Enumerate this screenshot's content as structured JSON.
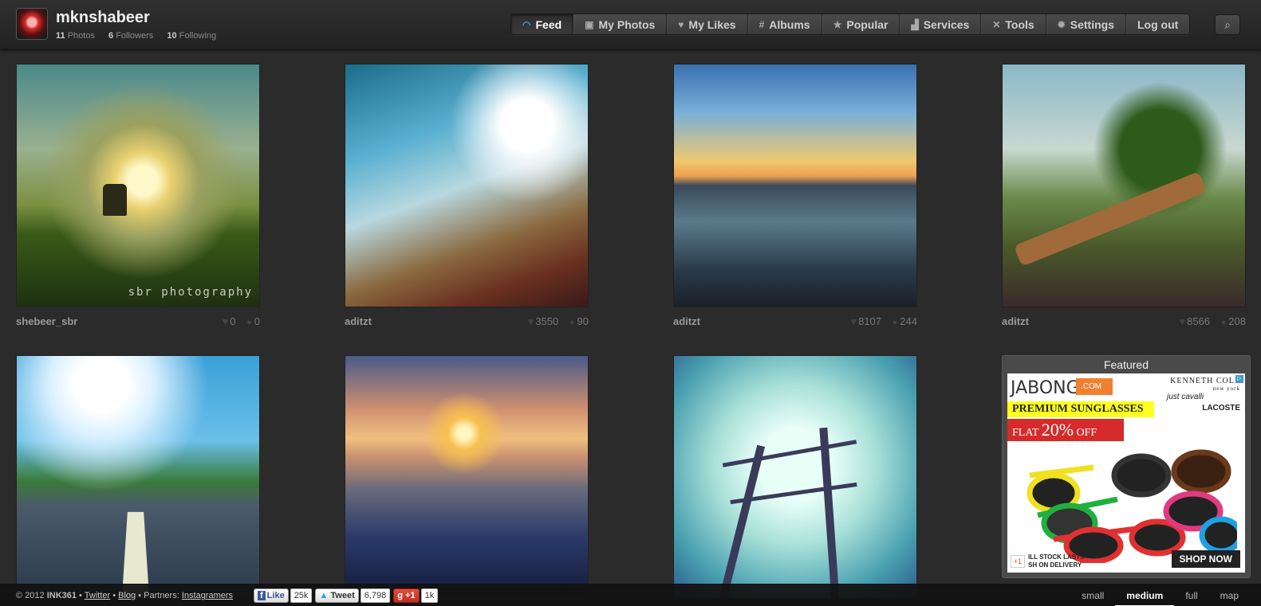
{
  "profile": {
    "username": "mknshabeer",
    "photos_count": "11",
    "photos_label": "Photos",
    "followers_count": "6",
    "followers_label": "Followers",
    "following_count": "10",
    "following_label": "Following"
  },
  "nav": {
    "items": [
      {
        "label": "Feed",
        "icon": "rss-icon",
        "active": true
      },
      {
        "label": "My Photos",
        "icon": "photo-icon"
      },
      {
        "label": "My Likes",
        "icon": "heart-icon"
      },
      {
        "label": "Albums",
        "icon": "hash-icon"
      },
      {
        "label": "Popular",
        "icon": "star-icon"
      },
      {
        "label": "Services",
        "icon": "chart-icon"
      },
      {
        "label": "Tools",
        "icon": "tools-icon"
      },
      {
        "label": "Settings",
        "icon": "gear-icon"
      },
      {
        "label": "Log out"
      }
    ],
    "search_icon": "search-icon"
  },
  "photos": [
    {
      "author": "shebeer_sbr",
      "likes": "0",
      "comments": "0",
      "watermark": "sbr photography"
    },
    {
      "author": "aditzt",
      "likes": "3550",
      "comments": "90"
    },
    {
      "author": "aditzt",
      "likes": "8107",
      "comments": "244"
    },
    {
      "author": "aditzt",
      "likes": "8566",
      "comments": "208"
    },
    {
      "author": "",
      "likes": "",
      "comments": ""
    },
    {
      "author": "",
      "likes": "",
      "comments": ""
    },
    {
      "author": "",
      "likes": "",
      "comments": ""
    }
  ],
  "featured": {
    "title": "Featured",
    "ad": {
      "brand": "JABONG",
      "brand_suffix": ".COM",
      "kenneth": "KENNETH COLE",
      "kenneth_sub": "new york",
      "cavalli": "just cavalli",
      "lacoste": "LACOSTE",
      "headline": "PREMIUM SUNGLASSES",
      "offer_prefix": "FLAT",
      "offer_value": "20%",
      "offer_suffix": "OFF",
      "stock_line1": "ILL STOCK LASTS",
      "stock_line2": "SH ON DELIVERY",
      "gplus": "+1",
      "cta": "SHOP NOW"
    }
  },
  "footer": {
    "copyright": "© 2012",
    "brand": "INK361",
    "twitter": "Twitter",
    "blog": "Blog",
    "partners_label": "Partners:",
    "partner": "Instagramers",
    "fb_label": "Like",
    "fb_count": "25k",
    "tw_label": "Tweet",
    "tw_count": "6,798",
    "gp_label": "+1",
    "gp_count": "1k"
  },
  "view_sizes": [
    {
      "label": "small"
    },
    {
      "label": "medium",
      "active": true
    },
    {
      "label": "full"
    },
    {
      "label": "map"
    }
  ],
  "colors": {
    "background": "#2b2b2b",
    "accent": "#5a9ad6",
    "ad_red": "#d52b2b",
    "ad_yellow": "#ffff20",
    "ad_orange": "#f08030"
  }
}
